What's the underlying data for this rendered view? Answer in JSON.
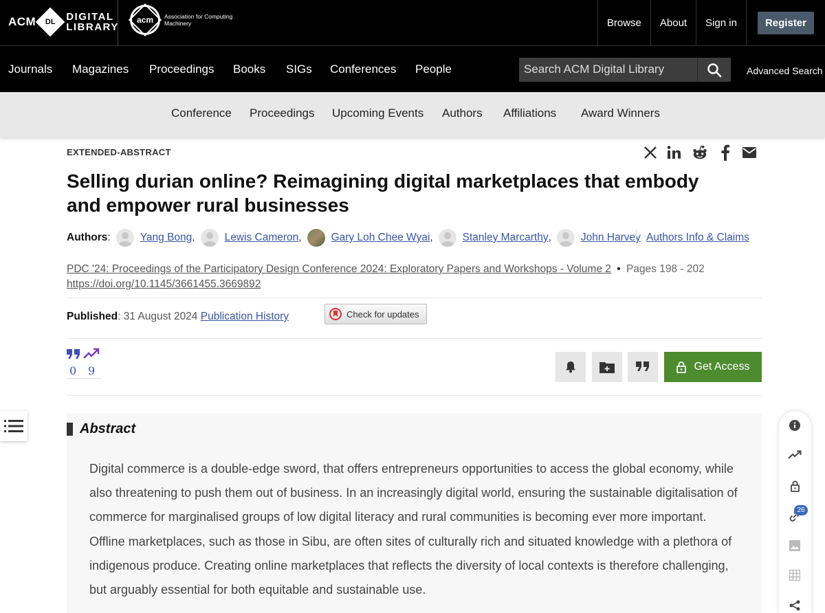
{
  "header": {
    "dl_logo": {
      "acm": "ACM",
      "badge": "DL",
      "line1": "DIGITAL",
      "line2": "LIBRARY"
    },
    "acm_logo": {
      "mark": "acm",
      "name": "Association for Computing Machinery"
    },
    "top_links": [
      "Browse",
      "About",
      "Sign in"
    ],
    "register_label": "Register"
  },
  "main_nav": {
    "items": [
      "Journals",
      "Magazines",
      "Proceedings",
      "Books",
      "SIGs",
      "Conferences",
      "People"
    ],
    "search_placeholder": "Search ACM Digital Library",
    "advanced_search": "Advanced Search"
  },
  "sub_nav": {
    "items": [
      "Conference",
      "Proceedings",
      "Upcoming Events",
      "Authors",
      "Affiliations",
      "Award Winners"
    ]
  },
  "article": {
    "type": "EXTENDED-ABSTRACT",
    "title": "Selling durian online? Reimagining digital marketplaces that embody and empower rural businesses",
    "authors_label": "Authors",
    "authors": [
      "Yang Bong",
      "Lewis Cameron",
      "Gary Loh Chee Wyai",
      "Stanley Marcarthy",
      "John Harvey"
    ],
    "authors_info": "Authors Info & Claims",
    "proceedings": "PDC '24: Proceedings of the Participatory Design Conference 2024: Exploratory Papers and Workshops - Volume 2",
    "bullet": "•",
    "pages": "Pages 198 - 202",
    "doi": "https://doi.org/10.1145/3661455.3669892",
    "published_label": "Published",
    "published_date": ": 31 August 2024 ",
    "publication_history": "Publication History",
    "check_updates": "Check for updates",
    "citations": "0",
    "downloads": "9",
    "get_access": "Get Access"
  },
  "abstract": {
    "heading": "Abstract",
    "text": "Digital commerce is a double-edge sword, that offers entrepreneurs opportunities to access the global economy, while also threatening to push them out of business. In an increasingly digital world, ensuring the sustainable digitalisation of commerce for marginalised groups of low digital literacy and rural communities is becoming ever more important. Offline marketplaces, such as those in Sibu, are often sites of culturally rich and situated knowledge with a plethora of indigenous produce. Creating online marketplaces that reflects the diversity of local contexts is therefore challenging, but arguably essential for both equitable and sustainable use."
  },
  "side_rail": {
    "references_count": "26"
  },
  "colors": {
    "access_green": "#4d8b2f",
    "link_blue": "#3a55a8",
    "metric_blue": "#3a4fb8"
  }
}
